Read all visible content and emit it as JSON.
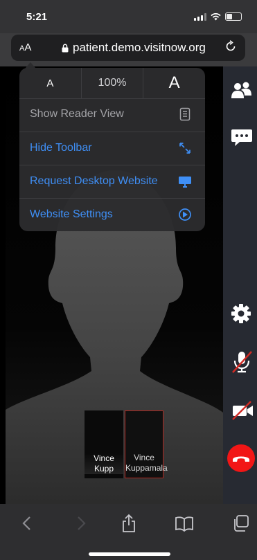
{
  "status_bar": {
    "time": "5:21"
  },
  "address_bar": {
    "aa_small": "A",
    "aa_large": "A",
    "url": "patient.demo.visitnow.org"
  },
  "popup": {
    "font_small": "A",
    "zoom": "100%",
    "font_large": "A",
    "items": [
      {
        "label": "Show Reader View",
        "icon": "reader-icon",
        "enabled": false
      },
      {
        "label": "Hide Toolbar",
        "icon": "expand-arrows-icon",
        "enabled": true
      },
      {
        "label": "Request Desktop Website",
        "icon": "desktop-icon",
        "enabled": true
      },
      {
        "label": "Website Settings",
        "icon": "settings-compass-icon",
        "enabled": true
      }
    ]
  },
  "call": {
    "thumbnails": [
      {
        "name": "Vince Kupp"
      },
      {
        "name": "Vince Kuppamala"
      }
    ],
    "controls": [
      "participants-icon",
      "chat-icon",
      "settings-gear-icon",
      "mic-muted-icon",
      "camera-off-icon",
      "hang-up-icon"
    ],
    "hangup_color": "#f21616"
  },
  "toolbar": [
    "back-icon",
    "forward-icon",
    "share-icon",
    "bookmarks-icon",
    "tabs-icon"
  ],
  "colors": {
    "accent": "#3f8ff6",
    "danger": "#f21616",
    "muted_slash": "#d12a24"
  }
}
